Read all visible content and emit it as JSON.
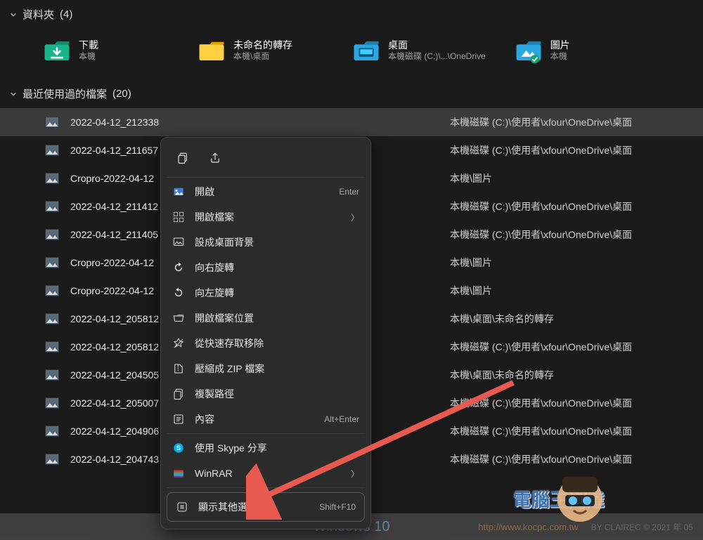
{
  "sections": {
    "folders": {
      "label": "資料夾",
      "count": 4
    },
    "recent": {
      "label": "最近使用過的檔案",
      "count": 20
    }
  },
  "folders": [
    {
      "title": "下載",
      "sub": "本機",
      "icon": "download"
    },
    {
      "title": "未命名的轉存",
      "sub": "本機\\桌面",
      "icon": "folder"
    },
    {
      "title": "桌面",
      "sub": "本機磁碟 (C:)\\...\\OneDrive",
      "icon": "desktop"
    },
    {
      "title": "圖片",
      "sub": "本機",
      "icon": "pictures"
    }
  ],
  "files": [
    {
      "name": "2022-04-12_212338",
      "path": "本機磁碟 (C:)\\使用者\\xfour\\OneDrive\\桌面",
      "selected": true
    },
    {
      "name": "2022-04-12_211657",
      "path": "本機磁碟 (C:)\\使用者\\xfour\\OneDrive\\桌面"
    },
    {
      "name": "Cropro-2022-04-12",
      "path": "本機\\圖片"
    },
    {
      "name": "2022-04-12_211412",
      "path": "本機磁碟 (C:)\\使用者\\xfour\\OneDrive\\桌面"
    },
    {
      "name": "2022-04-12_211405",
      "path": "本機磁碟 (C:)\\使用者\\xfour\\OneDrive\\桌面"
    },
    {
      "name": "Cropro-2022-04-12",
      "path": "本機\\圖片"
    },
    {
      "name": "Cropro-2022-04-12",
      "path": "本機\\圖片"
    },
    {
      "name": "2022-04-12_205812",
      "path": "本機\\桌面\\未命名的轉存"
    },
    {
      "name": "2022-04-12_205812",
      "path": "本機磁碟 (C:)\\使用者\\xfour\\OneDrive\\桌面"
    },
    {
      "name": "2022-04-12_204505",
      "path": "本機\\桌面\\未命名的轉存"
    },
    {
      "name": "2022-04-12_205007",
      "path": "本機磁碟 (C:)\\使用者\\xfour\\OneDrive\\桌面"
    },
    {
      "name": "2022-04-12_204906",
      "path": "本機磁碟 (C:)\\使用者\\xfour\\OneDrive\\桌面"
    },
    {
      "name": "2022-04-12_204743",
      "path": "本機磁碟 (C:)\\使用者\\xfour\\OneDrive\\桌面"
    }
  ],
  "context_menu": {
    "top_icons": [
      {
        "name": "copy-icon"
      },
      {
        "name": "share-icon"
      }
    ],
    "items": [
      {
        "icon": "image",
        "label": "開啟",
        "hint": "Enter"
      },
      {
        "icon": "apps",
        "label": "開啟檔案",
        "submenu": true
      },
      {
        "icon": "wallpaper",
        "label": "設成桌面背景"
      },
      {
        "icon": "rotate-right",
        "label": "向右旋轉"
      },
      {
        "icon": "rotate-left",
        "label": "向左旋轉"
      },
      {
        "icon": "folder-open",
        "label": "開啟檔案位置"
      },
      {
        "icon": "unpin",
        "label": "從快速存取移除"
      },
      {
        "icon": "zip",
        "label": "壓縮成 ZIP 檔案"
      },
      {
        "icon": "copy-path",
        "label": "複製路徑"
      },
      {
        "icon": "properties",
        "label": "內容",
        "hint": "Alt+Enter"
      },
      {
        "icon": "skype",
        "label": "使用 Skype 分享"
      },
      {
        "icon": "winrar",
        "label": "WinRAR",
        "submenu": true
      }
    ],
    "more": {
      "label": "顯示其他選項",
      "hint": "Shift+F10"
    }
  },
  "watermark": {
    "brand": "Windows 10",
    "logo_text": "電腦王阿達",
    "site": "http://www.kocpc.com.tw",
    "byline": "BY CLAIREC © 2021 年 05"
  }
}
